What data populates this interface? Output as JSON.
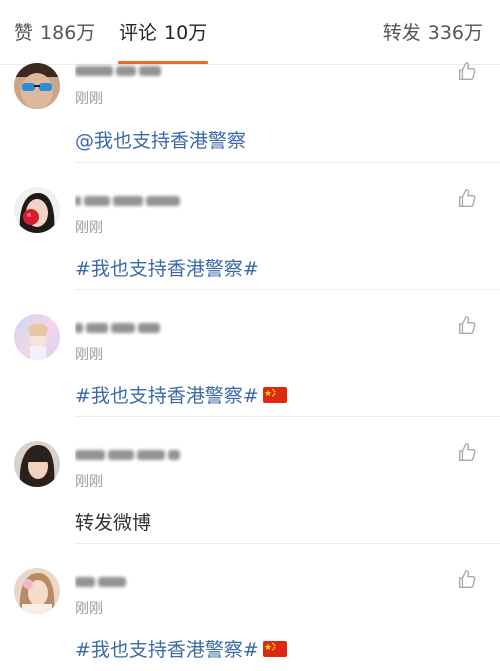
{
  "tabs": {
    "likes": {
      "label": "赞",
      "count": "186万"
    },
    "comments": {
      "label": "评论",
      "count": "10万"
    },
    "reposts": {
      "label": "转发",
      "count": "336万"
    }
  },
  "comments": [
    {
      "username": "",
      "time": "刚刚",
      "text": "@我也支持香港警察",
      "has_flag": false
    },
    {
      "username": "",
      "time": "刚刚",
      "text": "#我也支持香港警察#",
      "has_flag": false
    },
    {
      "username": "",
      "time": "刚刚",
      "text": "#我也支持香港警察#",
      "has_flag": true
    },
    {
      "username": "",
      "time": "刚刚",
      "text": "转发微博",
      "has_flag": false
    },
    {
      "username": "",
      "time": "刚刚",
      "text": "#我也支持香港警察#",
      "has_flag": true
    }
  ],
  "icons": {
    "like": "thumbs-up-icon",
    "flag": "china-flag-icon"
  },
  "colors": {
    "accent": "#e86b2c",
    "link": "#3b6aa5",
    "muted": "#9a9a9a"
  }
}
